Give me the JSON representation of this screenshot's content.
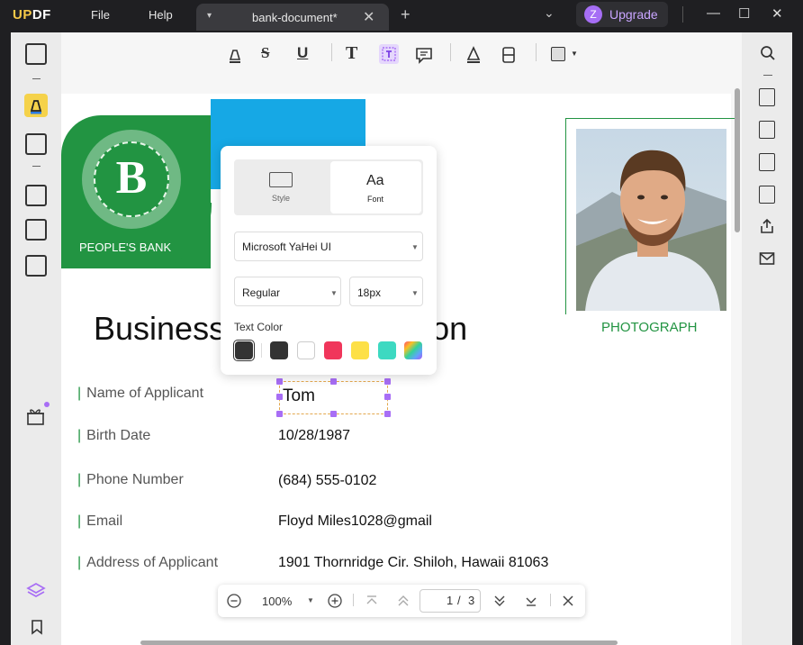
{
  "app": {
    "logo_u": "UP",
    "logo_rest": "DF"
  },
  "menu": {
    "file": "File",
    "help": "Help"
  },
  "tab": {
    "title": "bank-document*",
    "close": "✕",
    "dropdown": "▾",
    "new": "+"
  },
  "header": {
    "chevron": "⌄",
    "upgrade_avatar": "Z",
    "upgrade_label": "Upgrade"
  },
  "window": {
    "minimize": "—",
    "maximize": "☐",
    "close": "✕"
  },
  "document": {
    "bank_name": "PEOPLE'S BANK",
    "logo_letter": "B",
    "title": "Business Application",
    "title_visible_left": "Business",
    "title_visible_right": "ation",
    "photo_caption": "PHOTOGRAPH",
    "fields": [
      {
        "label": "Name of Applicant",
        "value": "Tom"
      },
      {
        "label": "Birth Date",
        "value": "10/28/1987"
      },
      {
        "label": "Phone Number",
        "value": "(684) 555-0102"
      },
      {
        "label": "Email",
        "value": "Floyd Miles1028@gmail"
      },
      {
        "label": "Address of Applicant",
        "value": "1901 Thornridge Cir. Shiloh, Hawaii 81063"
      }
    ]
  },
  "popup": {
    "style_label": "Style",
    "font_label": "Font",
    "font_icon": "Aa",
    "font_family": "Microsoft YaHei UI",
    "font_weight": "Regular",
    "font_size": "18px",
    "text_color_label": "Text Color",
    "swatches": [
      "#333333",
      "#333333",
      "#ffffff",
      "#f0365b",
      "#fde047",
      "#3dd9c1",
      "rainbow"
    ]
  },
  "zoom": {
    "level": "100%",
    "page_current": "1",
    "page_sep": "/",
    "page_total": "3"
  },
  "colors": {
    "accent": "#229442",
    "brand_purple": "#a86ef5",
    "blue": "#16a8e5"
  }
}
